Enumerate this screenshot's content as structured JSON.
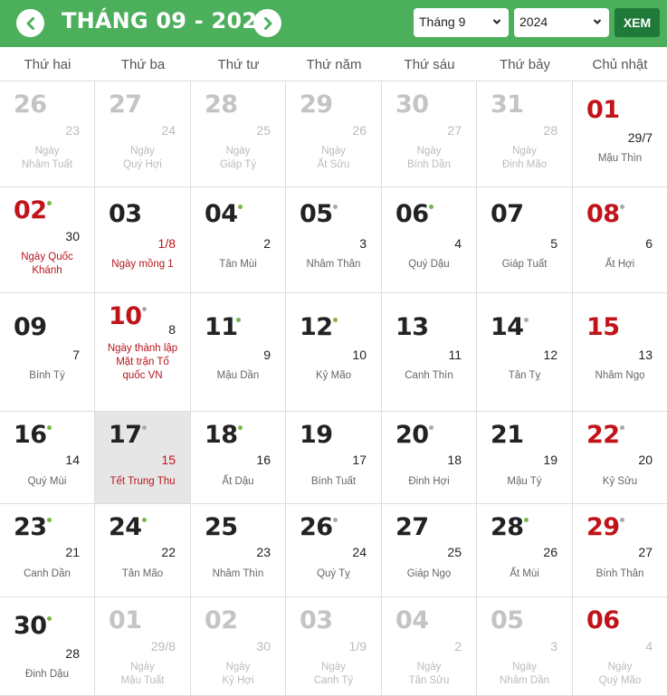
{
  "header": {
    "title": "THÁNG 09 - 2024",
    "prev_icon": "chevron-left-icon",
    "next_icon": "chevron-right-icon",
    "month_select": {
      "value": "Tháng 9"
    },
    "year_select": {
      "value": "2024"
    },
    "view_button": "XEM"
  },
  "weekdays": [
    "Thứ hai",
    "Thứ ba",
    "Thứ tư",
    "Thứ năm",
    "Thứ sáu",
    "Thứ bảy",
    "Chủ nhật"
  ],
  "colors": {
    "header_green": "#4caf5b",
    "button_green": "#1f7a3a",
    "holiday_red": "#c0131a",
    "good_day_dot": "#7ab648",
    "neutral_day_dot": "#aaaaaa",
    "today_bg": "#e6e6e6"
  },
  "weeks": [
    [
      {
        "solar": "26",
        "lunar": "23",
        "desc": "Ngày\nNhâm Tuất",
        "other": true
      },
      {
        "solar": "27",
        "lunar": "24",
        "desc": "Ngày\nQuý Hợi",
        "other": true
      },
      {
        "solar": "28",
        "lunar": "25",
        "desc": "Ngày\nGiáp Tý",
        "other": true
      },
      {
        "solar": "29",
        "lunar": "26",
        "desc": "Ngày\nẤt Sửu",
        "other": true
      },
      {
        "solar": "30",
        "lunar": "27",
        "desc": "Ngày\nBính Dần",
        "other": true
      },
      {
        "solar": "31",
        "lunar": "28",
        "desc": "Ngày\nĐinh Mão",
        "other": true
      },
      {
        "solar": "01",
        "lunar": "29/7",
        "desc": "Mậu Thìn",
        "red": true
      }
    ],
    [
      {
        "solar": "02",
        "lunar": "30",
        "desc": "Ngày Quốc\nKhánh",
        "red": true,
        "dot": "green",
        "desc_red": true
      },
      {
        "solar": "03",
        "lunar": "1/8",
        "desc": "Ngày mồng 1",
        "lunar_red": true,
        "desc_red": true
      },
      {
        "solar": "04",
        "lunar": "2",
        "desc": "Tân Mùi",
        "dot": "green"
      },
      {
        "solar": "05",
        "lunar": "3",
        "desc": "Nhâm Thân",
        "dot": "gray"
      },
      {
        "solar": "06",
        "lunar": "4",
        "desc": "Quý Dậu",
        "dot": "green"
      },
      {
        "solar": "07",
        "lunar": "5",
        "desc": "Giáp Tuất"
      },
      {
        "solar": "08",
        "lunar": "6",
        "desc": "Ất Hợi",
        "red": true,
        "dot": "gray"
      }
    ],
    [
      {
        "solar": "09",
        "lunar": "7",
        "desc": "Bính Tý"
      },
      {
        "solar": "10",
        "lunar": "8",
        "desc": "Ngày thành lập\nMặt trận Tổ\nquốc VN",
        "red": true,
        "dot": "gray",
        "desc_red": true,
        "tall": true
      },
      {
        "solar": "11",
        "lunar": "9",
        "desc": "Mậu Dần",
        "dot": "green"
      },
      {
        "solar": "12",
        "lunar": "10",
        "desc": "Kỷ Mão",
        "dot": "green"
      },
      {
        "solar": "13",
        "lunar": "11",
        "desc": "Canh Thìn"
      },
      {
        "solar": "14",
        "lunar": "12",
        "desc": "Tân Tỵ",
        "dot": "gray"
      },
      {
        "solar": "15",
        "lunar": "13",
        "desc": "Nhâm Ngọ",
        "red": true
      }
    ],
    [
      {
        "solar": "16",
        "lunar": "14",
        "desc": "Quý Mùi",
        "dot": "green"
      },
      {
        "solar": "17",
        "lunar": "15",
        "desc": "Tết Trung Thu",
        "dot": "gray",
        "today": true,
        "lunar_red": true,
        "desc_red": true
      },
      {
        "solar": "18",
        "lunar": "16",
        "desc": "Ất Dậu",
        "dot": "green"
      },
      {
        "solar": "19",
        "lunar": "17",
        "desc": "Bính Tuất"
      },
      {
        "solar": "20",
        "lunar": "18",
        "desc": "Đinh Hợi",
        "dot": "gray"
      },
      {
        "solar": "21",
        "lunar": "19",
        "desc": "Mậu Tý"
      },
      {
        "solar": "22",
        "lunar": "20",
        "desc": "Kỷ Sửu",
        "red": true,
        "dot": "gray"
      }
    ],
    [
      {
        "solar": "23",
        "lunar": "21",
        "desc": "Canh Dần",
        "dot": "green"
      },
      {
        "solar": "24",
        "lunar": "22",
        "desc": "Tân Mão",
        "dot": "green"
      },
      {
        "solar": "25",
        "lunar": "23",
        "desc": "Nhâm Thìn"
      },
      {
        "solar": "26",
        "lunar": "24",
        "desc": "Quý Tỵ",
        "dot": "gray"
      },
      {
        "solar": "27",
        "lunar": "25",
        "desc": "Giáp Ngọ"
      },
      {
        "solar": "28",
        "lunar": "26",
        "desc": "Ất Mùi",
        "dot": "green"
      },
      {
        "solar": "29",
        "lunar": "27",
        "desc": "Bính Thân",
        "red": true,
        "dot": "gray"
      }
    ],
    [
      {
        "solar": "30",
        "lunar": "28",
        "desc": "Đinh Dậu",
        "dot": "green"
      },
      {
        "solar": "01",
        "lunar": "29/8",
        "desc": "Ngày\nMậu Tuất",
        "other": true
      },
      {
        "solar": "02",
        "lunar": "30",
        "desc": "Ngày\nKỷ Hợi",
        "other": true
      },
      {
        "solar": "03",
        "lunar": "1/9",
        "desc": "Ngày\nCanh Tý",
        "other": true
      },
      {
        "solar": "04",
        "lunar": "2",
        "desc": "Ngày\nTân Sửu",
        "other": true
      },
      {
        "solar": "05",
        "lunar": "3",
        "desc": "Ngày\nNhâm Dần",
        "other": true
      },
      {
        "solar": "06",
        "lunar": "4",
        "desc": "Ngày\nQuý Mão",
        "other": true,
        "red": true
      }
    ]
  ]
}
